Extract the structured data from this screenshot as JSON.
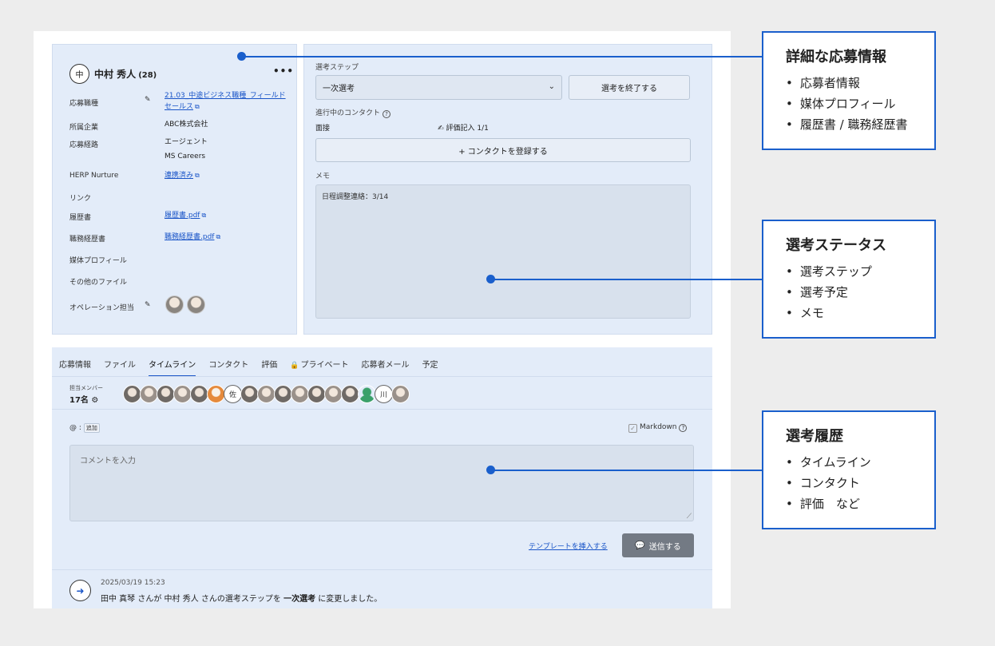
{
  "candidate": {
    "initial": "中",
    "name": "中村 秀人",
    "age": "(28)"
  },
  "info": {
    "rows": [
      {
        "label": "応募職種",
        "value": "21.03_中途ビジネス職種_フィールド",
        "value2": "セールス"
      },
      {
        "label": "所属企業",
        "value": "ABC株式会社"
      },
      {
        "label": "応募経路",
        "value": "エージェント",
        "value2": "MS Careers"
      },
      {
        "label": "HERP Nurture",
        "value": "連携済み"
      },
      {
        "label": "リンク",
        "value": ""
      },
      {
        "label": "履歴書",
        "value": "履歴書.pdf"
      },
      {
        "label": "職務経歴書",
        "value": "職務経歴書.pdf"
      },
      {
        "label": "媒体プロフィール",
        "value": ""
      },
      {
        "label": "その他のファイル",
        "value": ""
      },
      {
        "label": "オペレーション担当",
        "value": ""
      }
    ]
  },
  "status": {
    "step_label": "選考ステップ",
    "step_value": "一次選考",
    "end_button": "選考を終了する",
    "contact_label": "進行中のコンタクト",
    "contact_type": "面接",
    "evaluation": "評価記入 1/1",
    "register_button": "+ コンタクトを登録する",
    "memo_label": "メモ",
    "memo_text": "日程調整連絡：3/14"
  },
  "tabs": [
    {
      "label": "応募情報"
    },
    {
      "label": "ファイル"
    },
    {
      "label": "タイムライン",
      "active": true
    },
    {
      "label": "コンタクト"
    },
    {
      "label": "評価"
    },
    {
      "label": "プライベート"
    },
    {
      "label": "応募者メール"
    },
    {
      "label": "予定"
    }
  ],
  "members": {
    "label": "担当メンバー",
    "count": "17名",
    "letter_avatars": [
      "佐",
      "川"
    ]
  },
  "comment": {
    "mention": "@ :",
    "mention_add": "追加",
    "markdown": "Markdown",
    "placeholder": "コメントを入力",
    "template_link": "テンプレートを挿入する",
    "send_button": "送信する"
  },
  "timeline": {
    "time": "2025/03/19 15:23",
    "text_prefix": "田中 真琴 さんが 中村 秀人 さんの選考ステップを ",
    "text_bold": "一次選考",
    "text_suffix": " に変更しました。"
  },
  "callouts": [
    {
      "title": "詳細な応募情報",
      "items": [
        "応募者情報",
        "媒体プロフィール",
        "履歴書 / 職務経歴書"
      ]
    },
    {
      "title": "選考ステータス",
      "items": [
        "選考ステップ",
        "選考予定",
        "メモ"
      ]
    },
    {
      "title": "選考履歴",
      "items": [
        "タイムライン",
        "コンタクト",
        "評価　など"
      ]
    }
  ],
  "colors": {
    "accent": "#1a5fcc",
    "panel": "#e3ecf9",
    "link": "#1a55c8",
    "send_button": "#737a84"
  }
}
